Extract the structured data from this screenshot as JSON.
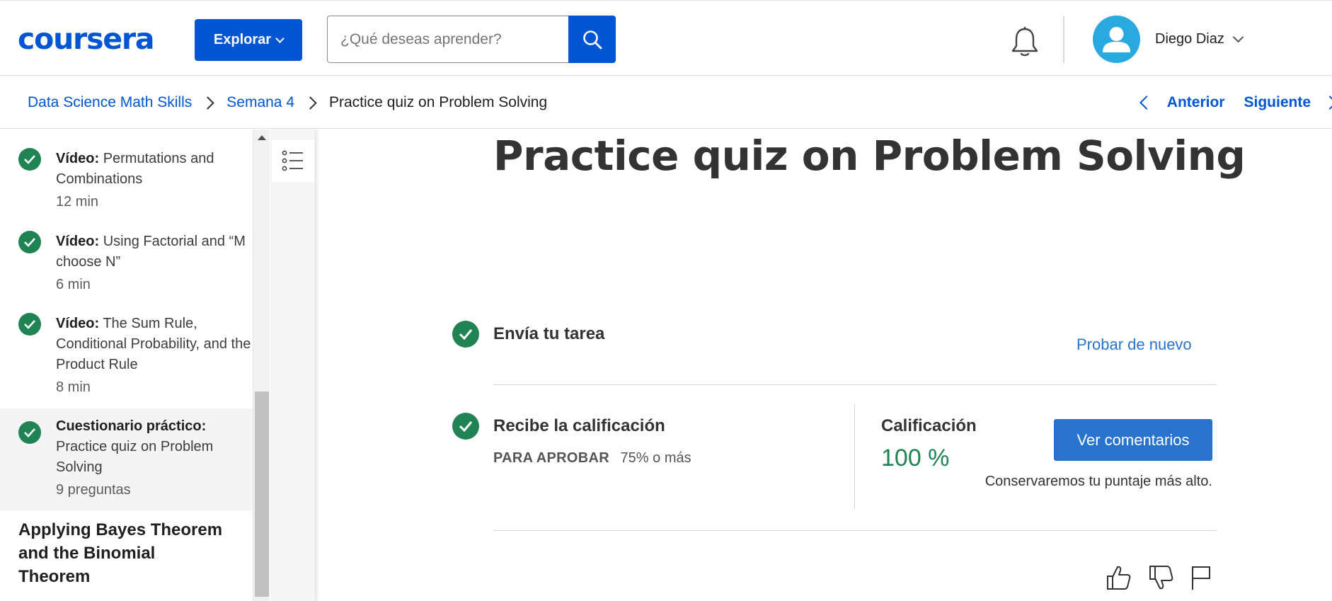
{
  "header": {
    "logo_text": "coursera",
    "explore_label": "Explorar",
    "search": {
      "placeholder": "¿Qué deseas aprender?",
      "value": ""
    },
    "user_name": "Diego Diaz"
  },
  "breadcrumb": {
    "items": [
      "Data Science Math Skills",
      "Semana 4"
    ],
    "current": "Practice quiz on Problem Solving"
  },
  "pager": {
    "prev_label": "Anterior",
    "next_label": "Siguiente"
  },
  "sidebar": {
    "items": [
      {
        "kind": "Vídeo:",
        "title": "Permutations and Combinations",
        "meta": "12 min",
        "completed": true,
        "active": false
      },
      {
        "kind": "Vídeo:",
        "title": "Using Factorial and “M choose N”",
        "meta": "6 min",
        "completed": true,
        "active": false
      },
      {
        "kind": "Vídeo:",
        "title": "The Sum Rule, Conditional Probability, and the Product Rule",
        "meta": "8 min",
        "completed": true,
        "active": false
      },
      {
        "kind": "Cuestionario práctico:",
        "title": "Practice quiz on Problem Solving",
        "meta": "9 preguntas",
        "completed": true,
        "active": true
      }
    ],
    "next_section_title": "Applying Bayes Theorem and the Binomial Theorem"
  },
  "main": {
    "title": "Practice quiz on Problem Solving",
    "submit_step": {
      "title": "Envía tu tarea",
      "action_label": "Probar de nuevo"
    },
    "grade_step": {
      "title": "Recibe la calificación",
      "pass_label": "PARA APROBAR",
      "pass_value": "75% o más",
      "grade_label": "Calificación",
      "grade_value": "100 %",
      "feedback_button": "Ver comentarios",
      "note": "Conservaremos tu puntaje más alto."
    }
  },
  "colors": {
    "brand_blue": "#0056d2",
    "link_blue": "#2a73cc",
    "success_green": "#1f8354",
    "avatar_blue": "#2aa8e0"
  },
  "icons": [
    "search-icon",
    "bell-icon",
    "user-avatar-icon",
    "chevron-down-icon",
    "chevron-left-icon",
    "chevron-right-icon",
    "check-circle-icon",
    "list-icon",
    "thumbs-up-icon",
    "thumbs-down-icon",
    "flag-icon"
  ]
}
